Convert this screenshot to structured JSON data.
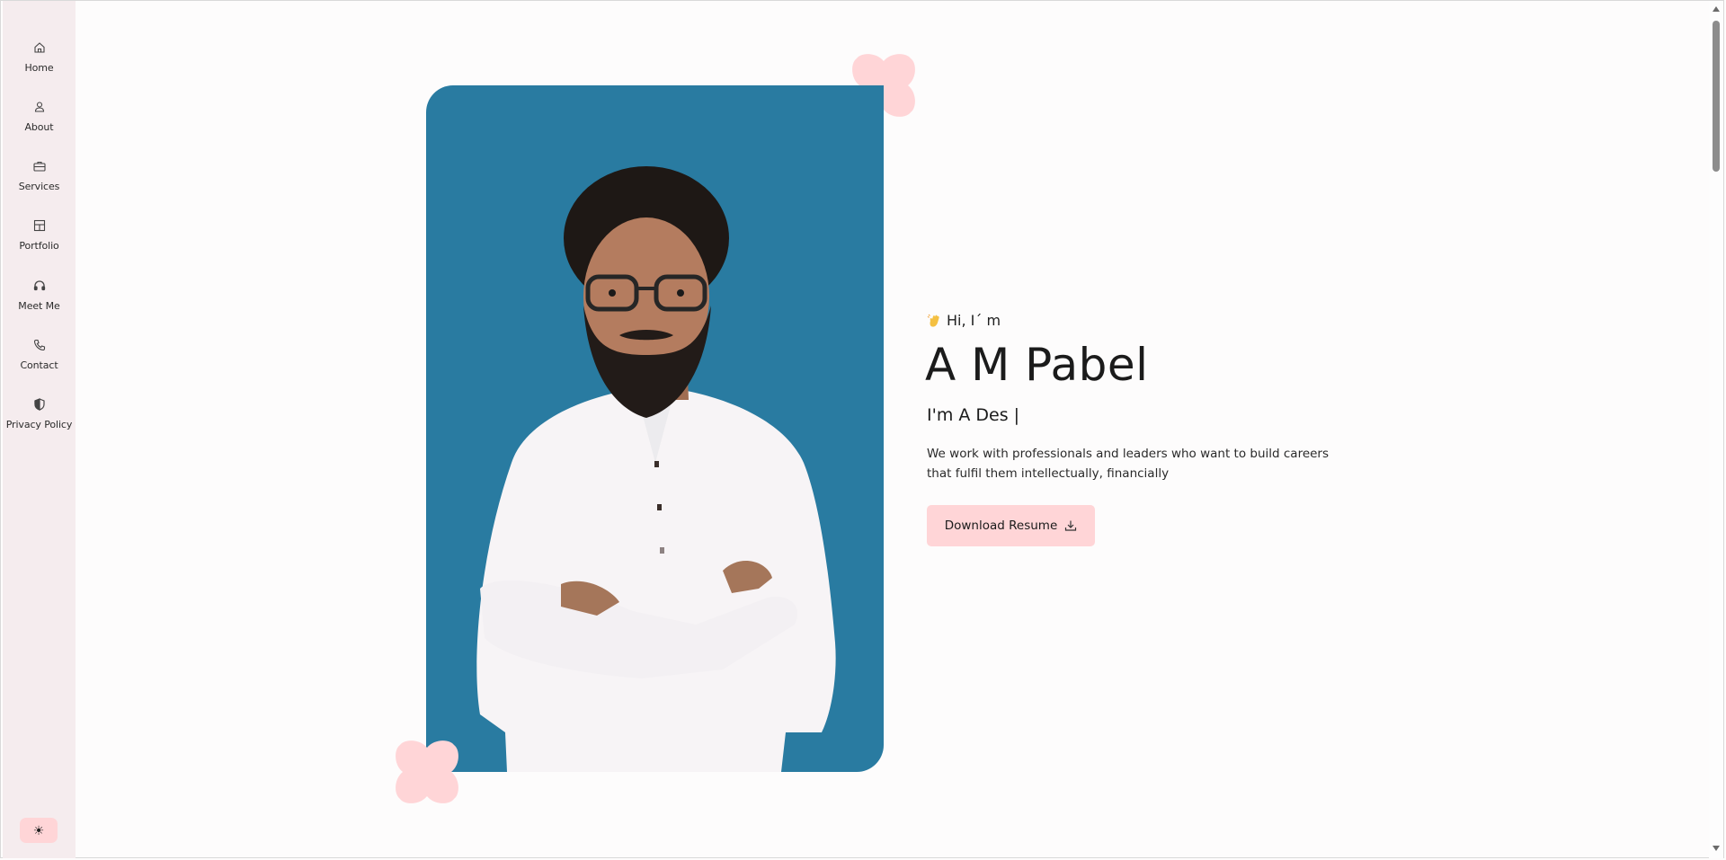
{
  "sidebar": {
    "items": [
      {
        "label": "Home",
        "icon": "home-icon"
      },
      {
        "label": "About",
        "icon": "user-icon"
      },
      {
        "label": "Services",
        "icon": "briefcase-icon"
      },
      {
        "label": "Portfolio",
        "icon": "layout-icon"
      },
      {
        "label": "Meet Me",
        "icon": "headset-icon"
      },
      {
        "label": "Contact",
        "icon": "phone-icon"
      },
      {
        "label": "Privacy Policy",
        "icon": "shield-icon"
      }
    ],
    "theme_toggle": {
      "label": "☀",
      "icon": "sun-icon"
    }
  },
  "hero": {
    "greeting": "Hi, I´ m",
    "name": "A M Pabel",
    "role": "I'm A Des |",
    "bio": "We work with professionals and leaders who want to build careers that fulfil them intellectually, financially",
    "download_label": "Download Resume",
    "download_icon": "download-icon"
  },
  "colors": {
    "accent": "#ffd5d7",
    "photo_background": "#297ba1",
    "sidebar_background": "#f5ecee",
    "page_background": "#fdfcfc"
  }
}
